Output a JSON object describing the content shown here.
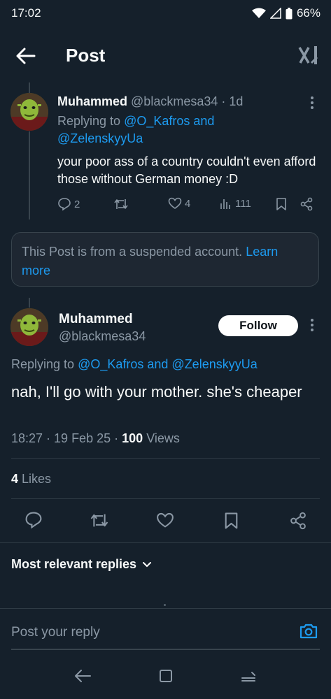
{
  "status_bar": {
    "time": "17:02",
    "battery": "66%"
  },
  "header": {
    "title": "Post"
  },
  "parent_post": {
    "display_name": "Muhammed",
    "handle": "@blackmesa34",
    "time_ago": "· 1d",
    "replying_prefix": "Replying to",
    "replying_line1": "@O_Kafros and",
    "replying_line2": "@ZelenskyyUa",
    "text": "your poor ass of a country couldn't even afford those without German money :D",
    "replies": "2",
    "likes": "4",
    "views": "111"
  },
  "suspended_notice": {
    "text": "This Post is from a suspended account.",
    "learn_more": "Learn more"
  },
  "main_post": {
    "display_name": "Muhammed",
    "handle": "@blackmesa34",
    "follow_label": "Follow",
    "replying_prefix": "Replying to",
    "replying_targets": "@O_Kafros and @ZelenskyyUa",
    "text": "nah, I'll go with your mother. she's cheaper",
    "timestamp": "18:27 · 19 Feb 25 ·",
    "views_count": "100",
    "views_label": "Views",
    "likes_count": "4",
    "likes_label": "Likes"
  },
  "replies_sort": {
    "label": "Most relevant replies"
  },
  "reply_composer": {
    "placeholder": "Post your reply"
  },
  "colors": {
    "background": "#15202b",
    "accent": "#1d9bf0",
    "muted": "#8b98a5"
  }
}
